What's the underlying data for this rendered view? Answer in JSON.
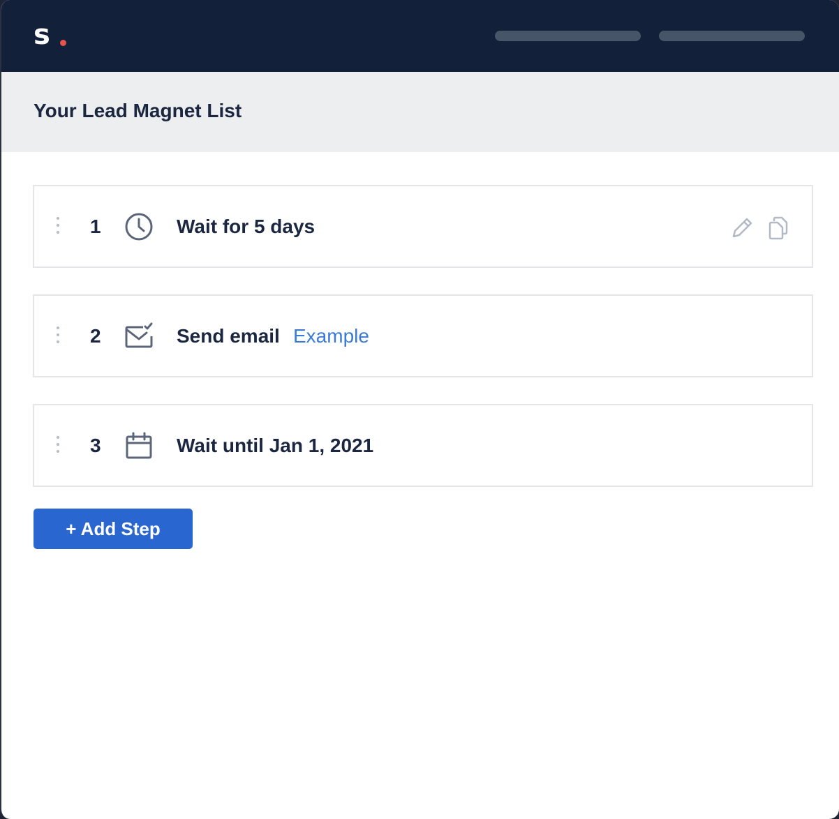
{
  "brand": {
    "logo_text": "s",
    "accent_color": "#e8534d"
  },
  "topbar": {
    "background": "#12203a"
  },
  "page": {
    "title": "Your Lead Magnet List"
  },
  "steps": [
    {
      "number": "1",
      "icon": "clock-icon",
      "text": "Wait for 5 days",
      "actions": [
        "edit-icon",
        "copy-icon"
      ]
    },
    {
      "number": "2",
      "icon": "email-check-icon",
      "text": "Send email",
      "link": "Example"
    },
    {
      "number": "3",
      "icon": "calendar-icon",
      "text": "Wait until Jan 1, 2021"
    }
  ],
  "actions": {
    "add_step_label": "+ Add Step"
  },
  "colors": {
    "primary": "#2a66d0",
    "link": "#3a7bd5",
    "text": "#1b2740"
  }
}
